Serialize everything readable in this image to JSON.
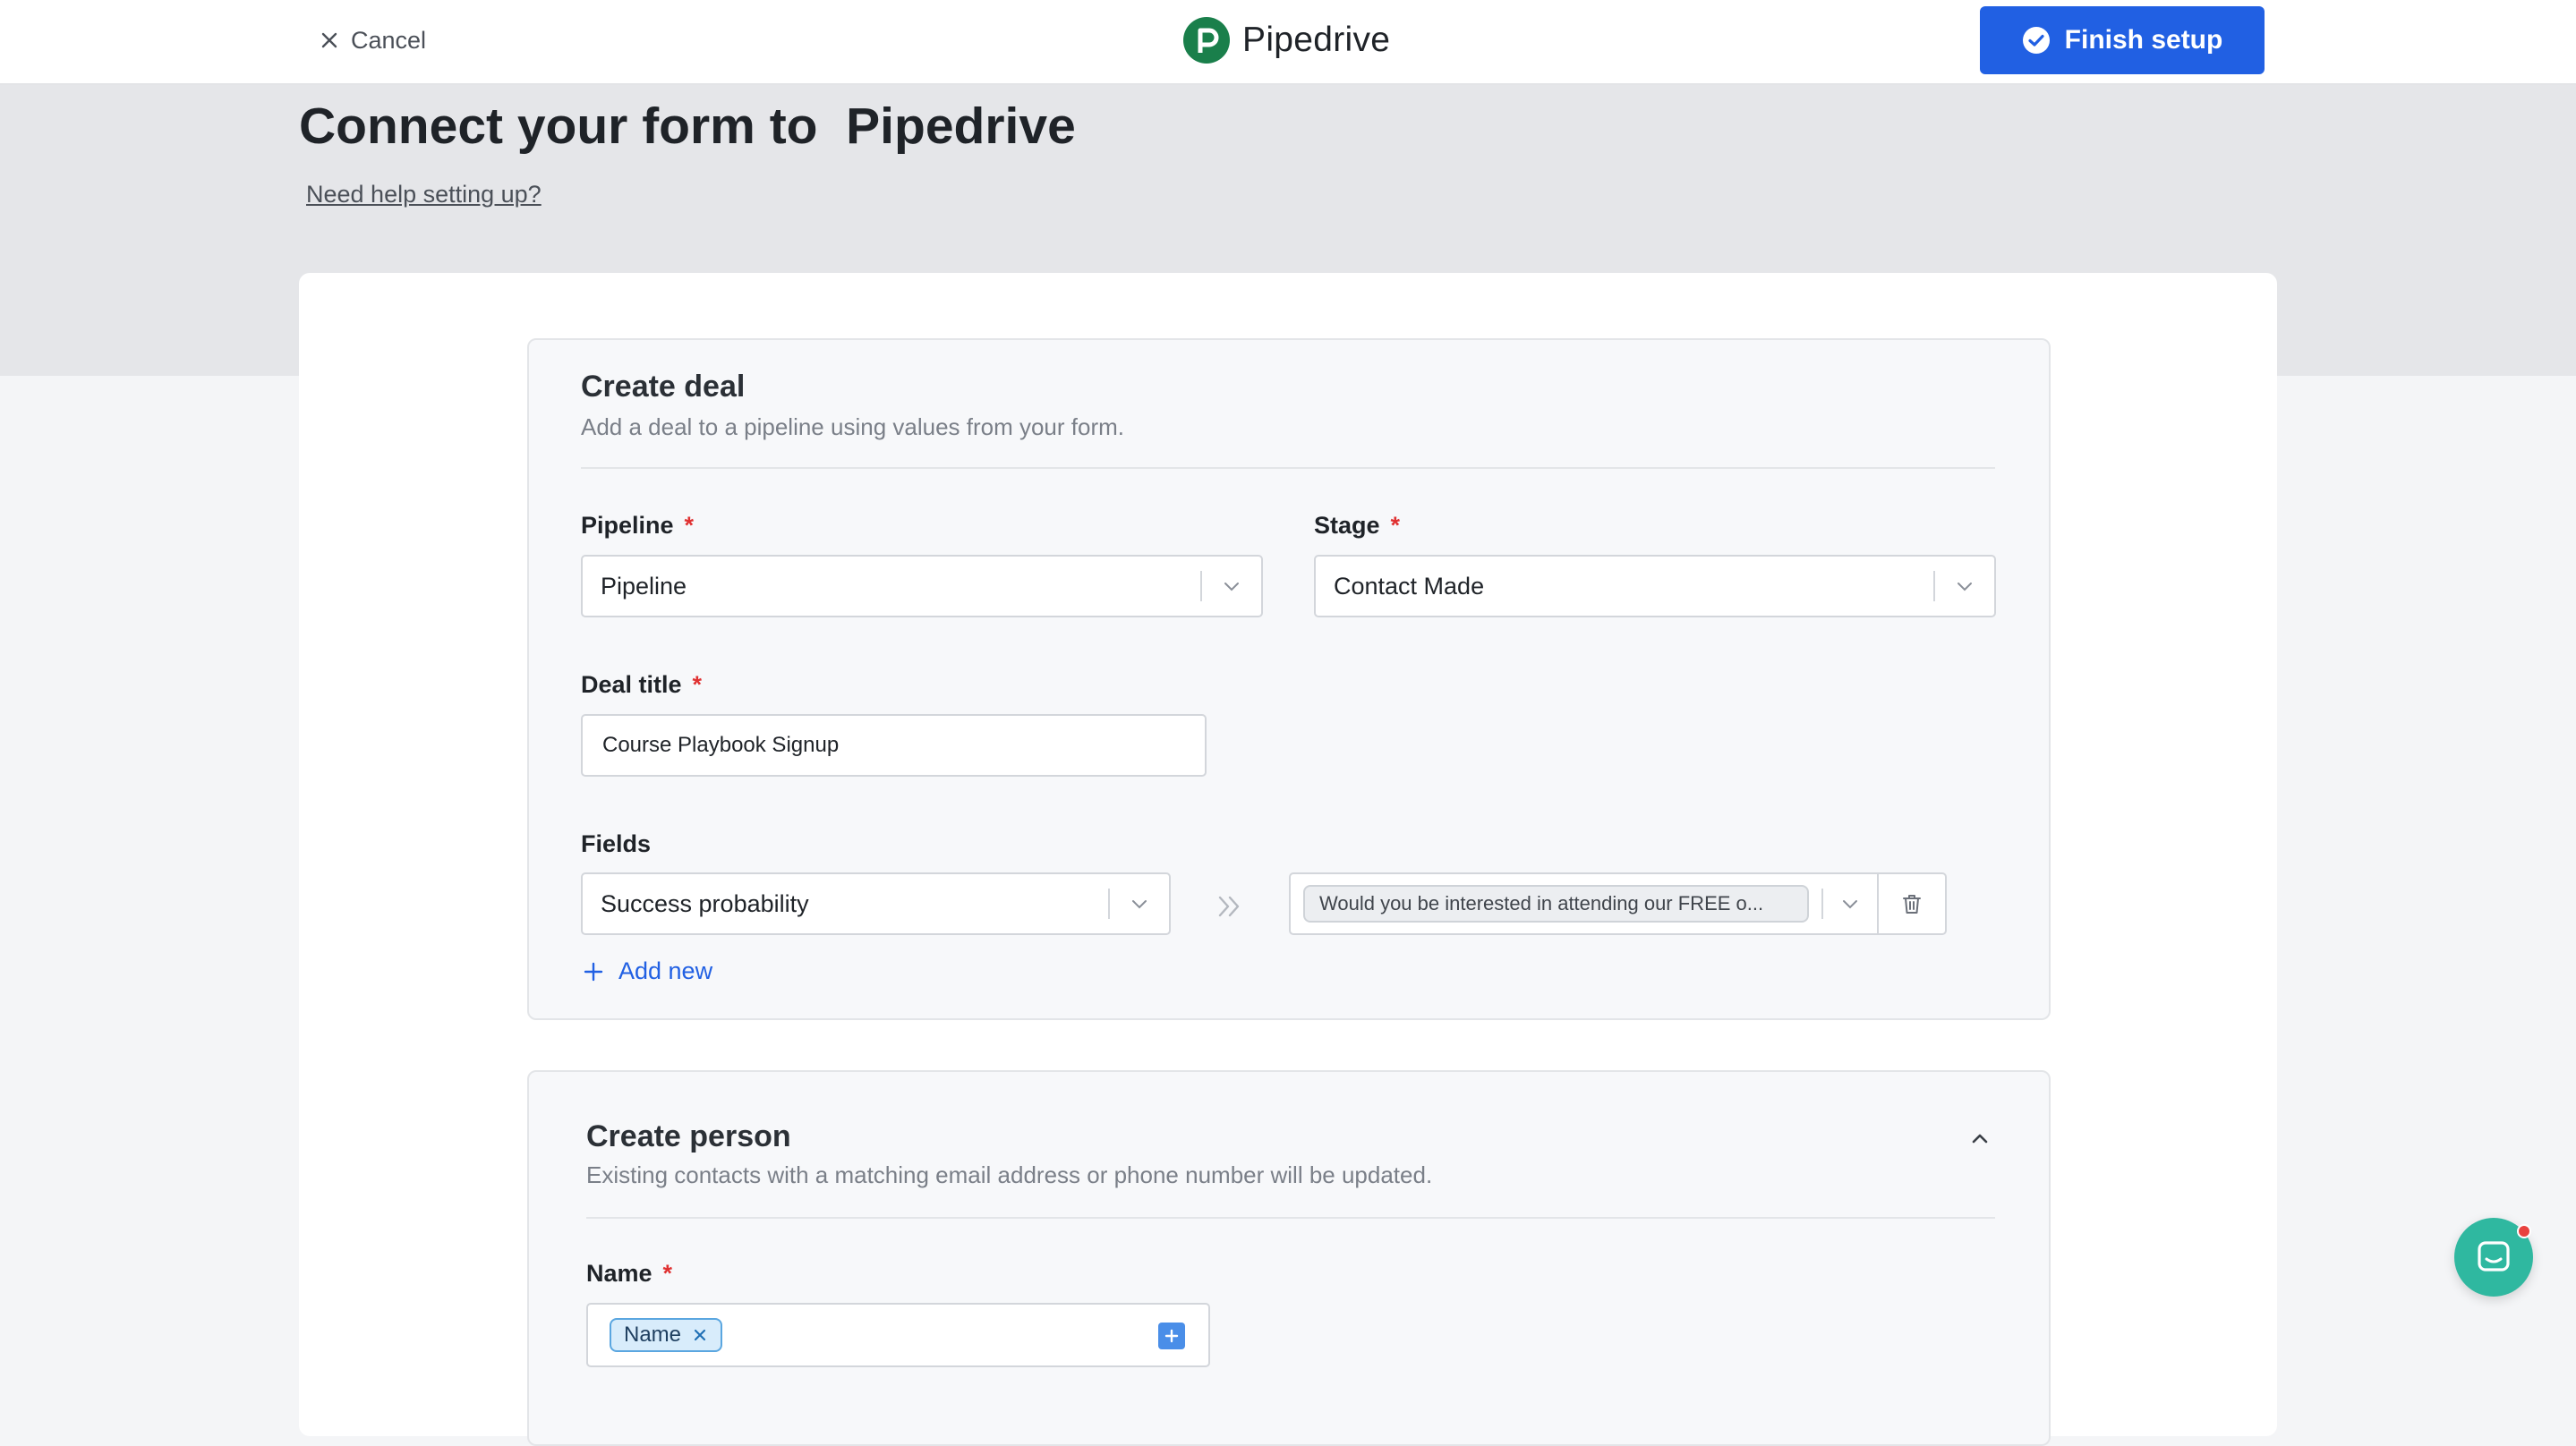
{
  "header": {
    "cancel_label": "Cancel",
    "brand_name": "Pipedrive",
    "finish_label": "Finish setup"
  },
  "page": {
    "title": "Connect your form to  Pipedrive",
    "help_link": "Need help setting up?"
  },
  "create_deal": {
    "title": "Create deal",
    "subtitle": "Add a deal to a pipeline using values from your form.",
    "pipeline": {
      "label": "Pipeline",
      "required_mark": "*",
      "value": "Pipeline"
    },
    "stage": {
      "label": "Stage",
      "required_mark": "*",
      "value": "Contact Made"
    },
    "deal_title": {
      "label": "Deal title",
      "required_mark": "*",
      "value": "Course Playbook Signup"
    },
    "fields": {
      "label": "Fields",
      "rows": [
        {
          "field": "Success probability",
          "mapped_value": "Would you be interested in attending our FREE o..."
        }
      ]
    },
    "add_new_label": "Add new"
  },
  "create_person": {
    "title": "Create person",
    "subtitle": "Existing contacts with a matching email address or phone number will be updated.",
    "name": {
      "label": "Name",
      "required_mark": "*",
      "chip": "Name"
    }
  },
  "colors": {
    "primary": "#2160e3",
    "brand_green": "#1a7f4b",
    "required": "#e03131",
    "chat": "#2fb8a0"
  }
}
